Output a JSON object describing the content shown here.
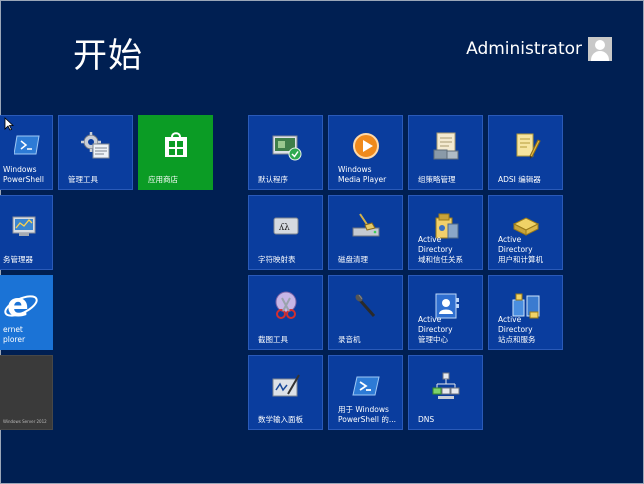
{
  "start": {
    "title": "开始"
  },
  "user": {
    "name": "Administrator"
  },
  "tiles": {
    "powershell_partial": "Windows\nPowerShell",
    "server_manager_partial": "务管理器",
    "ie_partial": "ernet\nplorer",
    "desktop_partial": "Windows Server 2012",
    "admin_tools": "管理工具",
    "store": "应用商店",
    "default_programs": "默认程序",
    "wmp": "Windows\nMedia Player",
    "gpo": "组策略管理",
    "adsi": "ADSI 编辑器",
    "charmap": "字符映射表",
    "cleanmgr": "磁盘清理",
    "ad_domains": "Active Directory\n域和信任关系",
    "ad_users": "Active Directory\n用户和计算机",
    "snipping": "截图工具",
    "recorder": "录音机",
    "ad_admin_center": "Active Directory\n管理中心",
    "ad_sites": "Active Directory\n站点和服务",
    "math_input": "数学输入面板",
    "ps_for_windows": "用于 Windows\nPowerShell 的...",
    "dns": "DNS"
  }
}
